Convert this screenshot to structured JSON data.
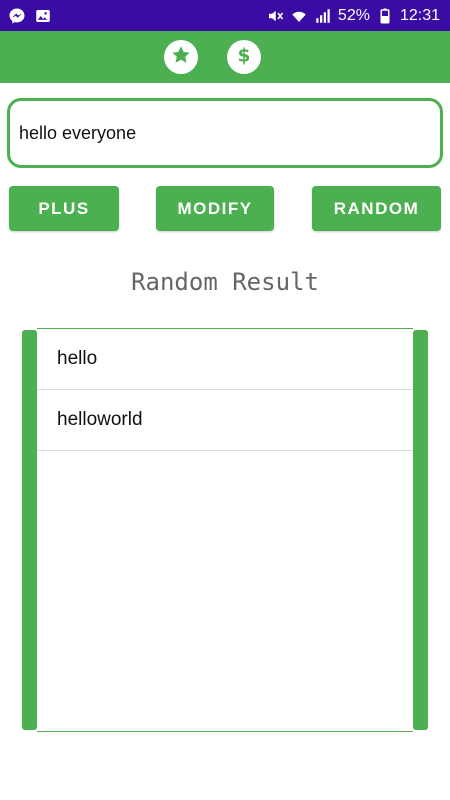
{
  "status_bar": {
    "battery": "52%",
    "time": "12:31"
  },
  "colors": {
    "status_bar": "#3a0ca3",
    "accent": "#4caf50"
  },
  "toolbar": {
    "star_icon": "star-icon",
    "dollar_icon": "dollar-icon"
  },
  "input": {
    "value": "hello everyone"
  },
  "buttons": {
    "plus": "PLUS",
    "modify": "MODIFY",
    "random": "RANDOM"
  },
  "section_title": "Random Result",
  "results": {
    "items": [
      "hello",
      "helloworld"
    ]
  }
}
